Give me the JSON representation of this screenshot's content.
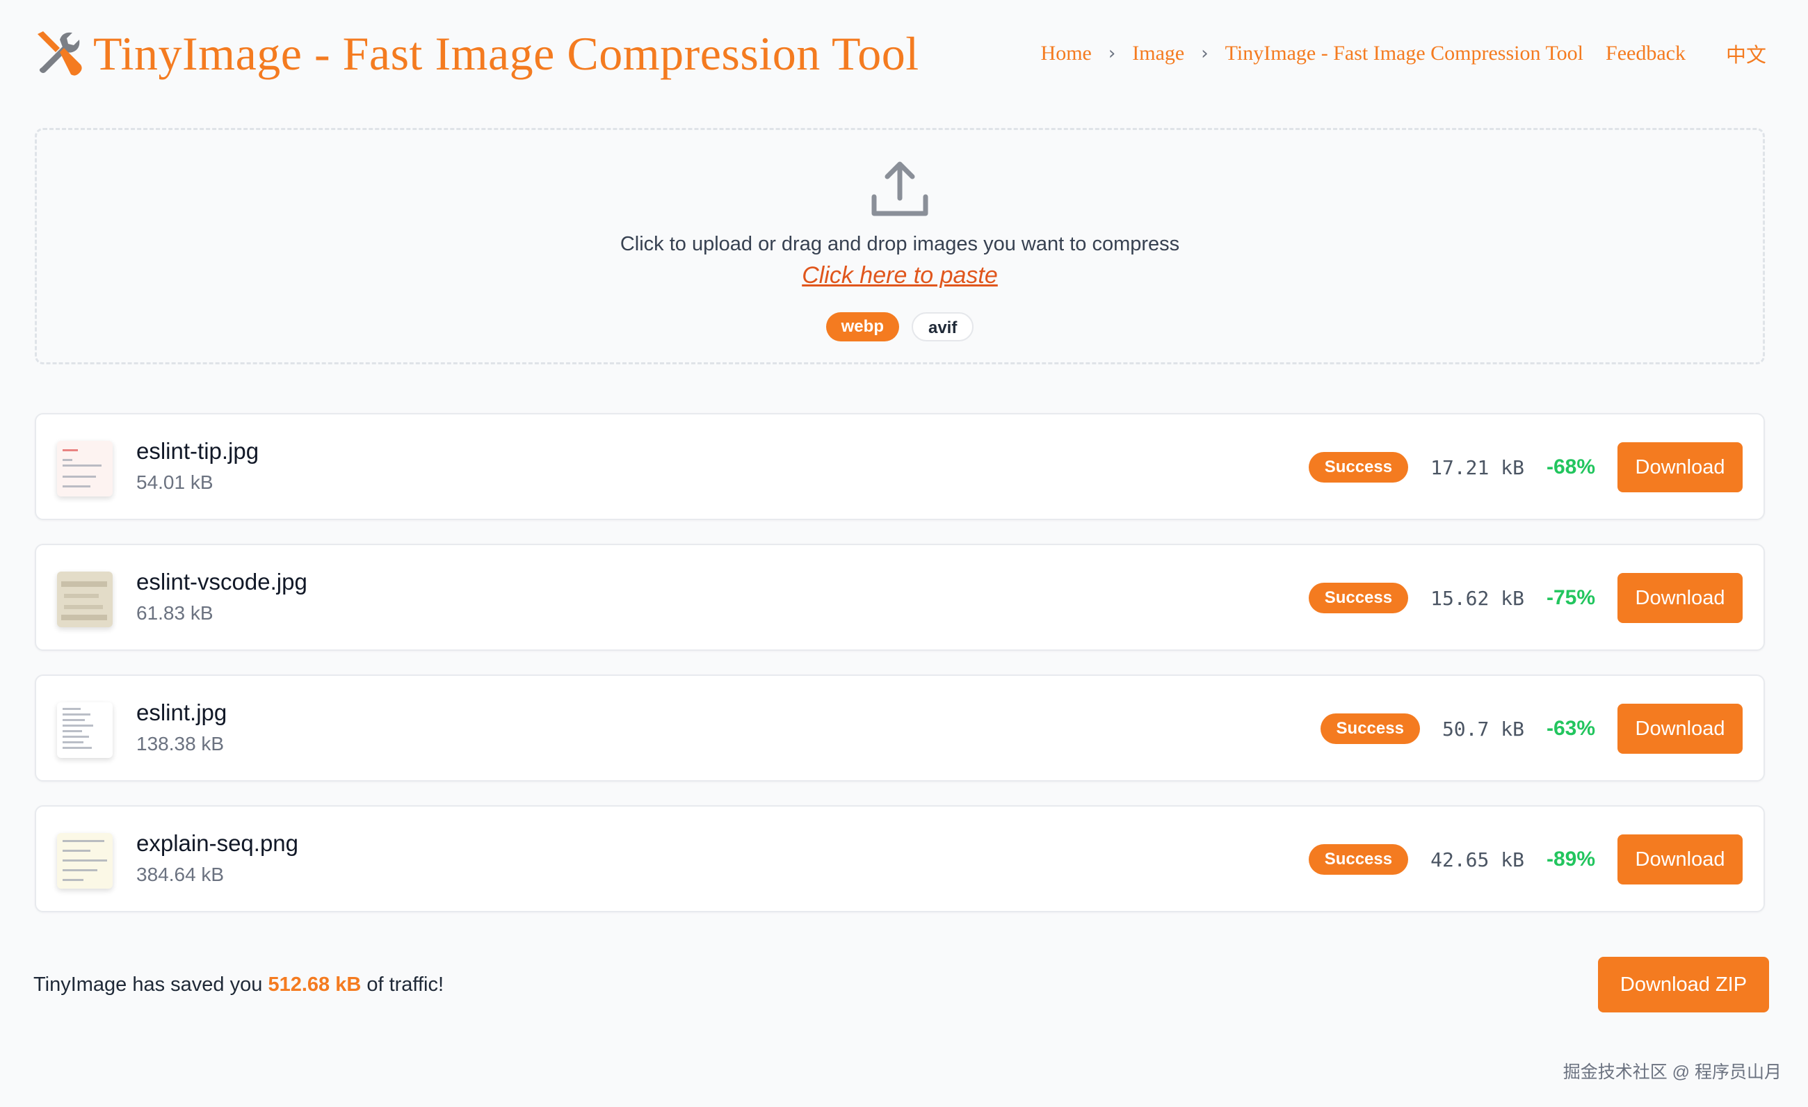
{
  "header": {
    "title": "TinyImage - Fast Image Compression Tool",
    "nav": {
      "home": "Home",
      "image": "Image",
      "current": "TinyImage - Fast Image Compression Tool",
      "feedback": "Feedback",
      "language": "中文"
    }
  },
  "upload": {
    "instruction": "Click to upload or drag and drop images you want to compress",
    "paste_link": "Click here to paste",
    "formats": [
      {
        "label": "webp",
        "selected": true
      },
      {
        "label": "avif",
        "selected": false
      }
    ]
  },
  "files": [
    {
      "name": "eslint-tip.jpg",
      "original_size": "54.01 kB",
      "status": "Success",
      "compressed_size": "17.21 kB",
      "saving": "-68%",
      "action": "Download"
    },
    {
      "name": "eslint-vscode.jpg",
      "original_size": "61.83 kB",
      "status": "Success",
      "compressed_size": "15.62 kB",
      "saving": "-75%",
      "action": "Download"
    },
    {
      "name": "eslint.jpg",
      "original_size": "138.38 kB",
      "status": "Success",
      "compressed_size": "50.7 kB",
      "saving": "-63%",
      "action": "Download"
    },
    {
      "name": "explain-seq.png",
      "original_size": "384.64 kB",
      "status": "Success",
      "compressed_size": "42.65 kB",
      "saving": "-89%",
      "action": "Download"
    }
  ],
  "summary": {
    "prefix": "TinyImage has saved you",
    "amount": "512.68 kB",
    "suffix": "of traffic!",
    "zip_button": "Download ZIP"
  },
  "watermark": "掘金技术社区 @ 程序员山月",
  "colors": {
    "accent": "#f47b20",
    "success_text": "#22c55e",
    "background": "#f9fafb"
  },
  "icons": {
    "logo": "tools-icon",
    "upload": "upload-icon"
  }
}
